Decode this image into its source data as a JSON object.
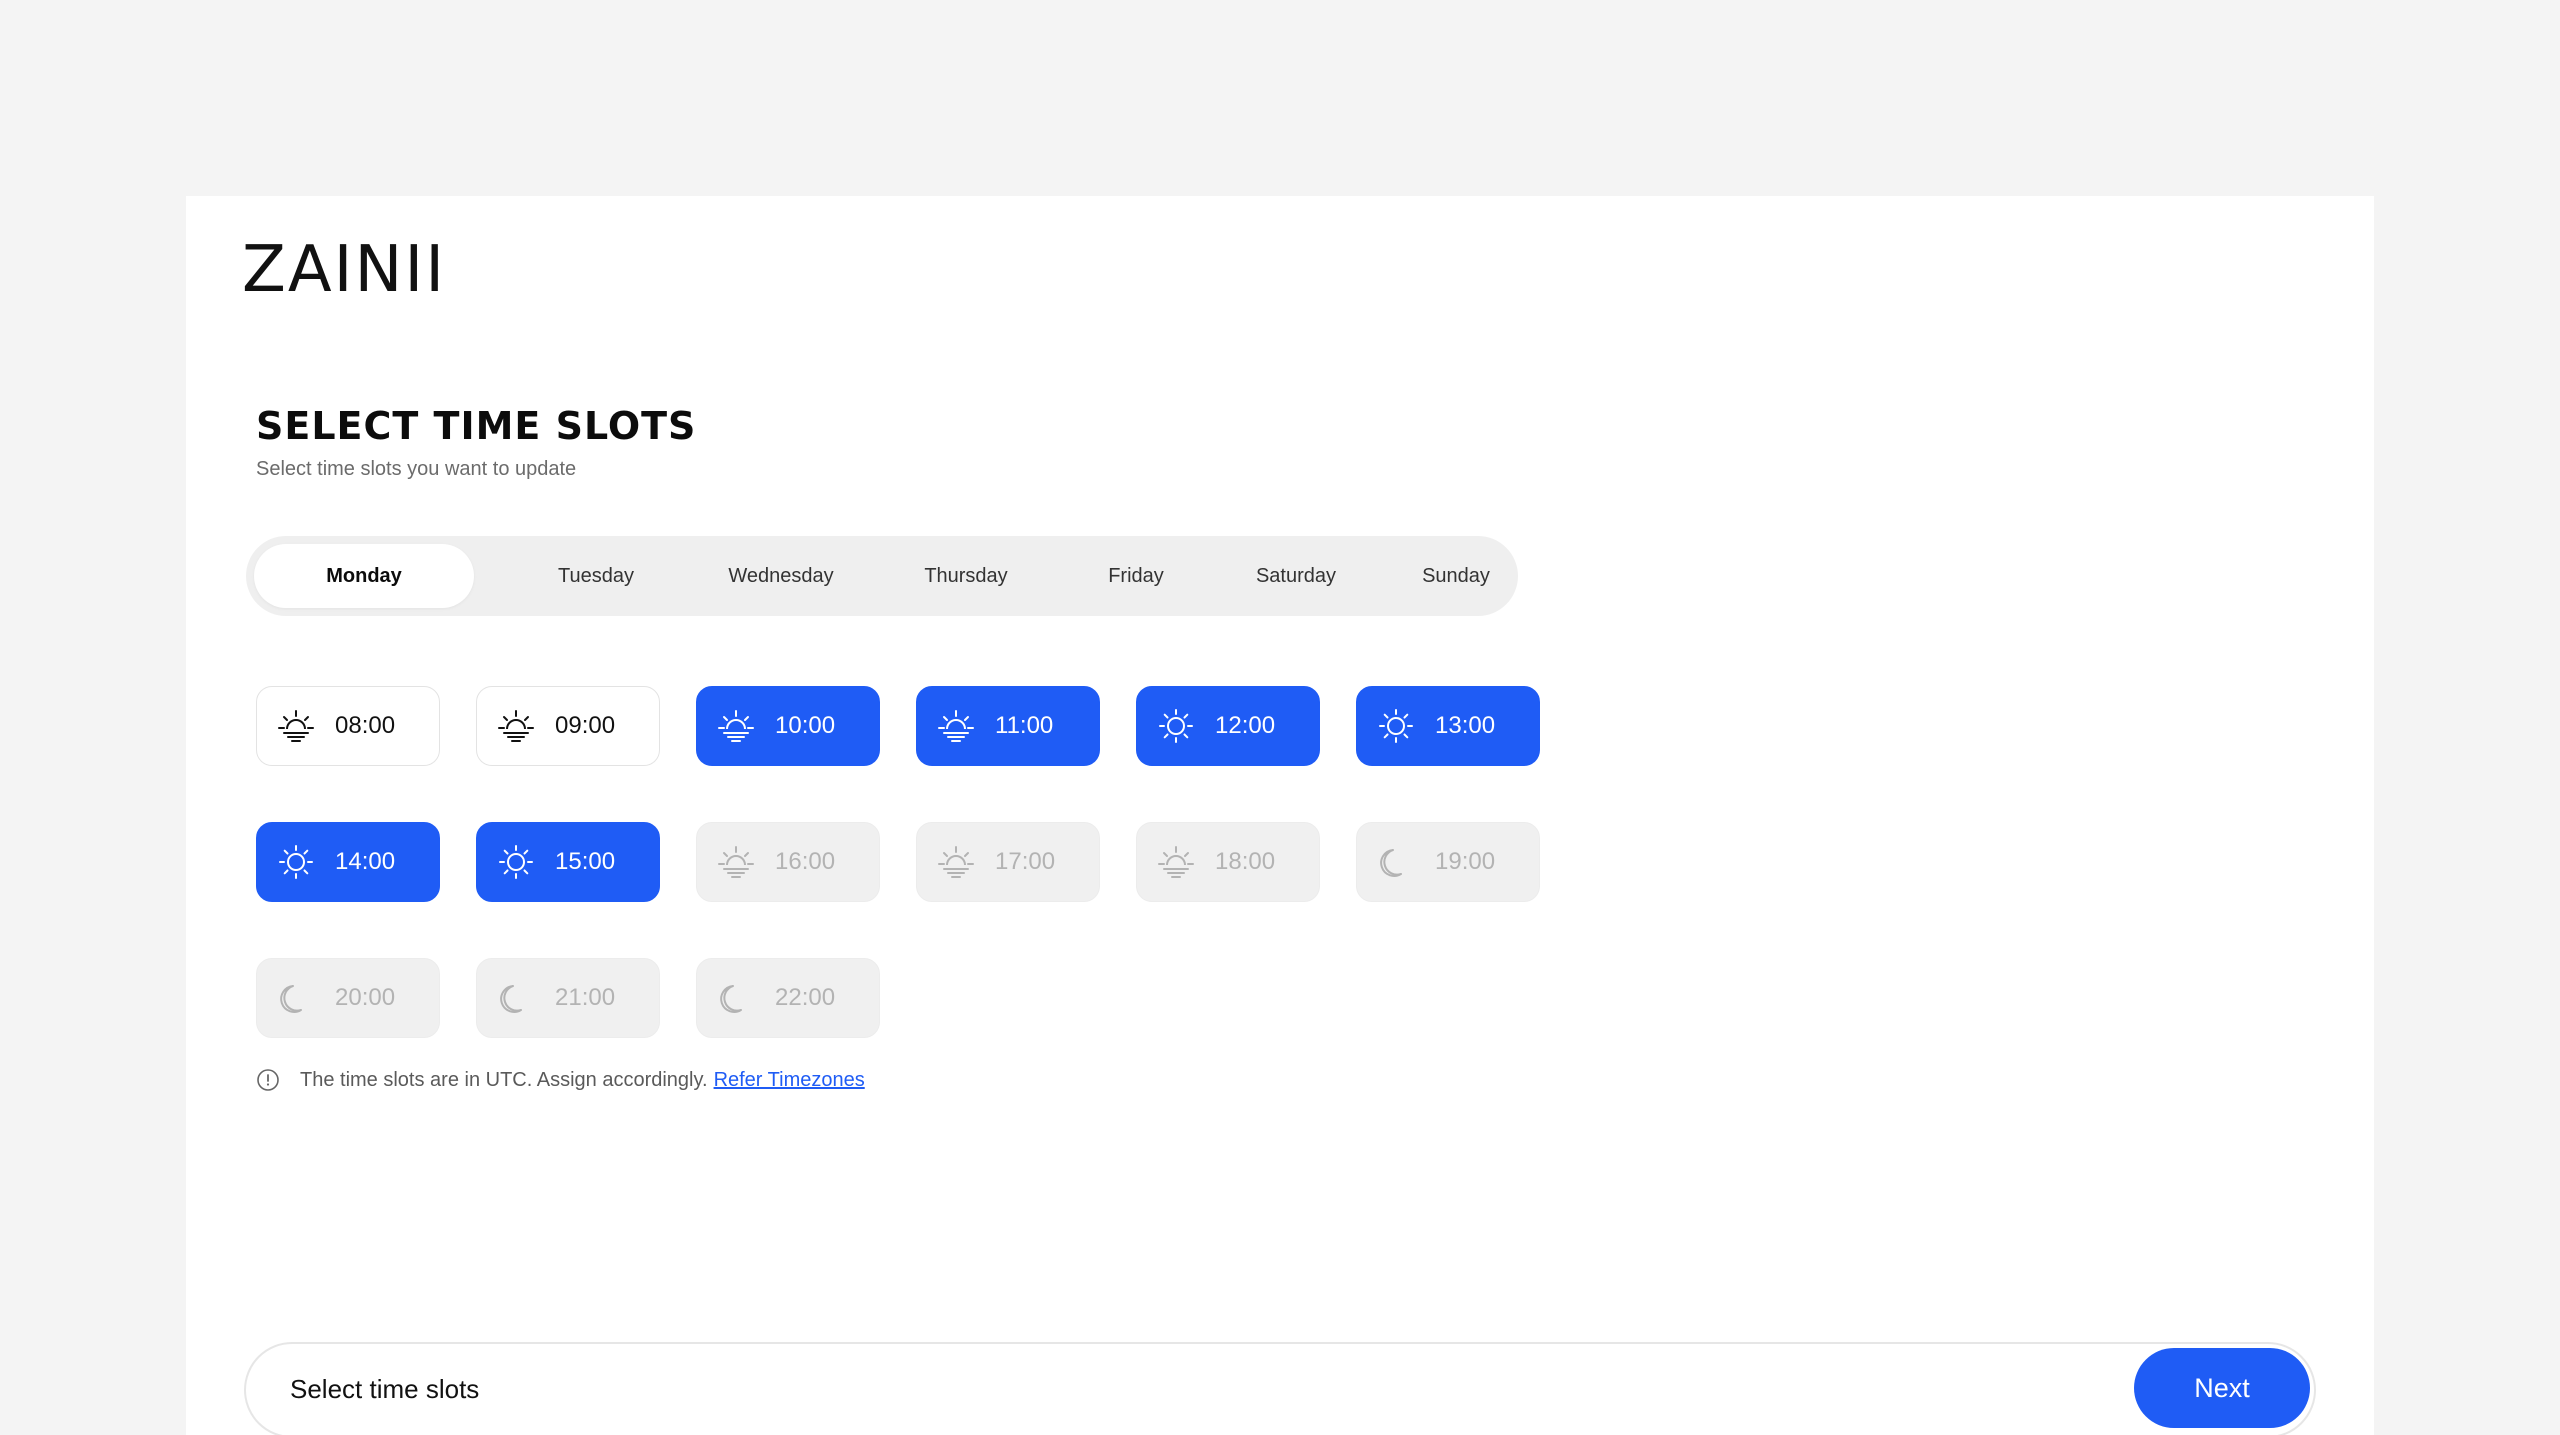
{
  "brand": {
    "logo": "ZAINII"
  },
  "header": {
    "title": "SELECT TIME SLOTS",
    "subtitle": "Select time slots you want to update"
  },
  "days": [
    {
      "label": "Monday",
      "active": true
    },
    {
      "label": "Tuesday",
      "active": false
    },
    {
      "label": "Wednesday",
      "active": false
    },
    {
      "label": "Thursday",
      "active": false
    },
    {
      "label": "Friday",
      "active": false
    },
    {
      "label": "Saturday",
      "active": false
    },
    {
      "label": "Sunday",
      "active": false
    }
  ],
  "slots": [
    {
      "time": "08:00",
      "state": "available",
      "icon": "sunrise-icon"
    },
    {
      "time": "09:00",
      "state": "available",
      "icon": "sunrise-icon"
    },
    {
      "time": "10:00",
      "state": "selected",
      "icon": "sunrise-icon"
    },
    {
      "time": "11:00",
      "state": "selected",
      "icon": "sunrise-icon"
    },
    {
      "time": "12:00",
      "state": "selected",
      "icon": "sun-icon"
    },
    {
      "time": "13:00",
      "state": "selected",
      "icon": "sun-icon"
    },
    {
      "time": "14:00",
      "state": "selected",
      "icon": "sun-icon"
    },
    {
      "time": "15:00",
      "state": "selected",
      "icon": "sun-icon"
    },
    {
      "time": "16:00",
      "state": "disabled",
      "icon": "sunrise-icon"
    },
    {
      "time": "17:00",
      "state": "disabled",
      "icon": "sunrise-icon"
    },
    {
      "time": "18:00",
      "state": "disabled",
      "icon": "sunrise-icon"
    },
    {
      "time": "19:00",
      "state": "disabled",
      "icon": "moon-icon"
    },
    {
      "time": "20:00",
      "state": "disabled",
      "icon": "moon-icon"
    },
    {
      "time": "21:00",
      "state": "disabled",
      "icon": "moon-icon"
    },
    {
      "time": "22:00",
      "state": "disabled",
      "icon": "moon-icon"
    }
  ],
  "note": {
    "text": "The time slots are in UTC. Assign accordingly.",
    "link": "Refer Timezones"
  },
  "footer": {
    "label": "Select time slots",
    "next": "Next"
  },
  "colors": {
    "accent": "#1f5cf5",
    "page_bg": "#f4f4f4",
    "disabled_bg": "#f0f0f0"
  }
}
